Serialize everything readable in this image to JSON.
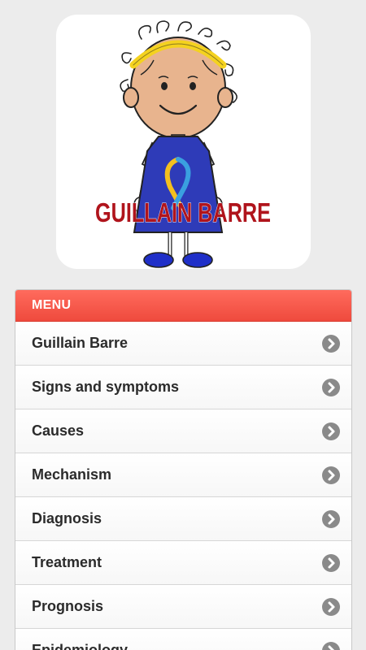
{
  "logo": {
    "text": "GUILLAIN BARRE",
    "text_color": "#b0141c"
  },
  "menu": {
    "header": "MENU",
    "header_color": "#f25548",
    "chevron_icon": "chevron-right-circle-icon",
    "items": [
      {
        "label": "Guillain Barre"
      },
      {
        "label": "Signs and symptoms"
      },
      {
        "label": "Causes"
      },
      {
        "label": "Mechanism"
      },
      {
        "label": "Diagnosis"
      },
      {
        "label": "Treatment"
      },
      {
        "label": "Prognosis"
      },
      {
        "label": "Epidemiology"
      }
    ]
  }
}
